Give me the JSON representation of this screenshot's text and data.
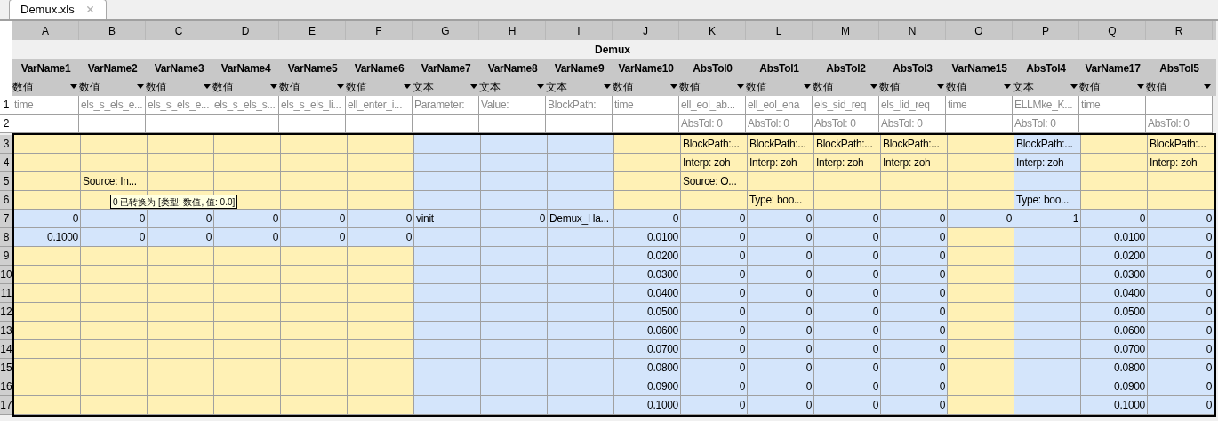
{
  "tab": {
    "title": "Demux.xls",
    "selected": true
  },
  "title": "Demux",
  "columns": [
    {
      "letter": "A",
      "name": "VarName1",
      "type": "数值"
    },
    {
      "letter": "B",
      "name": "VarName2",
      "type": "数值"
    },
    {
      "letter": "C",
      "name": "VarName3",
      "type": "数值"
    },
    {
      "letter": "D",
      "name": "VarName4",
      "type": "数值"
    },
    {
      "letter": "E",
      "name": "VarName5",
      "type": "数值"
    },
    {
      "letter": "F",
      "name": "VarName6",
      "type": "数值"
    },
    {
      "letter": "G",
      "name": "VarName7",
      "type": "文本"
    },
    {
      "letter": "H",
      "name": "VarName8",
      "type": "文本"
    },
    {
      "letter": "I",
      "name": "VarName9",
      "type": "文本"
    },
    {
      "letter": "J",
      "name": "VarName10",
      "type": "数值"
    },
    {
      "letter": "K",
      "name": "AbsTol0",
      "type": "数值"
    },
    {
      "letter": "L",
      "name": "AbsTol1",
      "type": "数值"
    },
    {
      "letter": "M",
      "name": "AbsTol2",
      "type": "数值"
    },
    {
      "letter": "N",
      "name": "AbsTol3",
      "type": "数值"
    },
    {
      "letter": "O",
      "name": "VarName15",
      "type": "数值"
    },
    {
      "letter": "P",
      "name": "AbsTol4",
      "type": "文本"
    },
    {
      "letter": "Q",
      "name": "VarName17",
      "type": "数值"
    },
    {
      "letter": "R",
      "name": "AbsTol5",
      "type": "数值"
    }
  ],
  "rows": [
    {
      "number": "1",
      "kind": "meta",
      "cells": [
        {
          "text": "time"
        },
        {
          "text": "els_s_els_e..."
        },
        {
          "text": "els_s_els_e..."
        },
        {
          "text": "els_s_els_s..."
        },
        {
          "text": "els_s_els_li..."
        },
        {
          "text": "ell_enter_i..."
        },
        {
          "text": "Parameter:"
        },
        {
          "text": "Value:"
        },
        {
          "text": "BlockPath:"
        },
        {
          "text": "time"
        },
        {
          "text": "ell_eol_ab..."
        },
        {
          "text": "ell_eol_ena"
        },
        {
          "text": "els_sid_req"
        },
        {
          "text": "els_lid_req"
        },
        {
          "text": "time"
        },
        {
          "text": "ELLMke_K..."
        },
        {
          "text": "time"
        },
        {}
      ]
    },
    {
      "number": "2",
      "kind": "meta",
      "cells": [
        {},
        {},
        {},
        {},
        {},
        {},
        {},
        {},
        {},
        {},
        {
          "text": "AbsTol: 0"
        },
        {
          "text": "AbsTol: 0"
        },
        {
          "text": "AbsTol: 0"
        },
        {
          "text": "AbsTol: 0"
        },
        {},
        {
          "text": "AbsTol: 0"
        },
        {},
        {
          "text": "AbsTol: 0"
        }
      ]
    },
    {
      "number": "3",
      "kind": "data",
      "cells": [
        {
          "color": "#fff1b5"
        },
        {
          "color": "#fff1b5"
        },
        {
          "color": "#fff1b5"
        },
        {
          "color": "#fff1b5"
        },
        {
          "color": "#fff1b5"
        },
        {
          "color": "#fff1b5"
        },
        {
          "color": "#d4e5fb"
        },
        {
          "color": "#d4e5fb"
        },
        {
          "color": "#d4e5fb"
        },
        {
          "color": "#fff1b5"
        },
        {
          "text": "BlockPath:...",
          "kind": "text",
          "color": "#fff1b5"
        },
        {
          "text": "BlockPath:...",
          "kind": "text",
          "color": "#fff1b5"
        },
        {
          "text": "BlockPath:...",
          "kind": "text",
          "color": "#fff1b5"
        },
        {
          "text": "BlockPath:...",
          "kind": "text",
          "color": "#fff1b5"
        },
        {
          "color": "#fff1b5"
        },
        {
          "text": "BlockPath:...",
          "kind": "text",
          "color": "#d4e5fb"
        },
        {
          "color": "#fff1b5"
        },
        {
          "text": "BlockPath:...",
          "kind": "text",
          "color": "#fff1b5"
        }
      ]
    },
    {
      "number": "4",
      "kind": "data",
      "cells": [
        {
          "color": "#fff1b5"
        },
        {
          "color": "#fff1b5"
        },
        {
          "color": "#fff1b5"
        },
        {
          "color": "#fff1b5"
        },
        {
          "color": "#fff1b5"
        },
        {
          "color": "#fff1b5"
        },
        {
          "color": "#d4e5fb"
        },
        {
          "color": "#d4e5fb"
        },
        {
          "color": "#d4e5fb"
        },
        {
          "color": "#fff1b5"
        },
        {
          "text": "Interp: zoh",
          "kind": "text",
          "color": "#fff1b5"
        },
        {
          "text": "Interp: zoh",
          "kind": "text",
          "color": "#fff1b5"
        },
        {
          "text": "Interp: zoh",
          "kind": "text",
          "color": "#fff1b5"
        },
        {
          "text": "Interp: zoh",
          "kind": "text",
          "color": "#fff1b5"
        },
        {
          "color": "#fff1b5"
        },
        {
          "text": "Interp: zoh",
          "kind": "text",
          "color": "#d4e5fb"
        },
        {
          "color": "#fff1b5"
        },
        {
          "text": "Interp: zoh",
          "kind": "text",
          "color": "#fff1b5"
        }
      ]
    },
    {
      "number": "5",
      "kind": "data",
      "cells": [
        {
          "color": "#fff1b5"
        },
        {
          "text": "Source: In...",
          "kind": "text",
          "color": "#fff1b5"
        },
        {
          "color": "#fff1b5"
        },
        {
          "color": "#fff1b5"
        },
        {
          "color": "#fff1b5"
        },
        {
          "color": "#fff1b5"
        },
        {
          "color": "#d4e5fb"
        },
        {
          "color": "#d4e5fb"
        },
        {
          "color": "#d4e5fb"
        },
        {
          "color": "#fff1b5"
        },
        {
          "text": "Source: O...",
          "kind": "text",
          "color": "#fff1b5"
        },
        {
          "color": "#fff1b5"
        },
        {
          "color": "#fff1b5"
        },
        {
          "color": "#fff1b5"
        },
        {
          "color": "#fff1b5"
        },
        {
          "color": "#d4e5fb"
        },
        {
          "color": "#fff1b5"
        },
        {
          "color": "#fff1b5"
        }
      ]
    },
    {
      "number": "6",
      "kind": "data",
      "cells": [
        {
          "color": "#fff1b5"
        },
        {
          "color": "#fff1b5"
        },
        {
          "color": "#fff1b5"
        },
        {
          "color": "#fff1b5"
        },
        {
          "color": "#fff1b5"
        },
        {
          "color": "#fff1b5"
        },
        {
          "color": "#d4e5fb"
        },
        {
          "color": "#d4e5fb"
        },
        {
          "color": "#d4e5fb"
        },
        {
          "color": "#fff1b5"
        },
        {
          "color": "#fff1b5"
        },
        {
          "text": "Type: boo...",
          "kind": "text",
          "color": "#fff1b5"
        },
        {
          "color": "#fff1b5"
        },
        {
          "color": "#fff1b5"
        },
        {
          "color": "#fff1b5"
        },
        {
          "text": "Type: boo...",
          "kind": "text",
          "color": "#d4e5fb"
        },
        {
          "color": "#fff1b5"
        },
        {
          "color": "#fff1b5"
        }
      ]
    },
    {
      "number": "7",
      "kind": "data",
      "cells": [
        {
          "text": "0",
          "kind": "number",
          "color": "#d4e5fb"
        },
        {
          "text": "0",
          "kind": "number",
          "color": "#d4e5fb"
        },
        {
          "text": "0",
          "kind": "number",
          "color": "#d4e5fb"
        },
        {
          "text": "0",
          "kind": "number",
          "color": "#d4e5fb"
        },
        {
          "text": "0",
          "kind": "number",
          "color": "#d4e5fb"
        },
        {
          "text": "0",
          "kind": "number",
          "color": "#d4e5fb"
        },
        {
          "text": "vinit",
          "kind": "text",
          "color": "#d4e5fb"
        },
        {
          "text": "0",
          "kind": "number",
          "color": "#d4e5fb"
        },
        {
          "text": "Demux_Ha...",
          "kind": "text",
          "color": "#d4e5fb"
        },
        {
          "text": "0",
          "kind": "number",
          "color": "#d4e5fb"
        },
        {
          "text": "0",
          "kind": "number",
          "color": "#d4e5fb"
        },
        {
          "text": "0",
          "kind": "number",
          "color": "#d4e5fb"
        },
        {
          "text": "0",
          "kind": "number",
          "color": "#d4e5fb"
        },
        {
          "text": "0",
          "kind": "number",
          "color": "#d4e5fb"
        },
        {
          "text": "0",
          "kind": "number",
          "color": "#d4e5fb"
        },
        {
          "text": "1",
          "kind": "number",
          "color": "#d4e5fb"
        },
        {
          "text": "0",
          "kind": "number",
          "color": "#d4e5fb"
        },
        {
          "text": "0",
          "kind": "number",
          "color": "#d4e5fb"
        }
      ]
    },
    {
      "number": "8",
      "kind": "data",
      "cells": [
        {
          "text": "0.1000",
          "kind": "number",
          "color": "#d4e5fb"
        },
        {
          "text": "0",
          "kind": "number",
          "color": "#d4e5fb"
        },
        {
          "text": "0",
          "kind": "number",
          "color": "#d4e5fb"
        },
        {
          "text": "0",
          "kind": "number",
          "color": "#d4e5fb"
        },
        {
          "text": "0",
          "kind": "number",
          "color": "#d4e5fb"
        },
        {
          "text": "0",
          "kind": "number",
          "color": "#d4e5fb"
        },
        {
          "color": "#d4e5fb"
        },
        {
          "color": "#d4e5fb"
        },
        {
          "color": "#d4e5fb"
        },
        {
          "text": "0.0100",
          "kind": "number",
          "color": "#d4e5fb"
        },
        {
          "text": "0",
          "kind": "number",
          "color": "#d4e5fb"
        },
        {
          "text": "0",
          "kind": "number",
          "color": "#d4e5fb"
        },
        {
          "text": "0",
          "kind": "number",
          "color": "#d4e5fb"
        },
        {
          "text": "0",
          "kind": "number",
          "color": "#d4e5fb"
        },
        {
          "color": "#fff1b5"
        },
        {
          "color": "#d4e5fb"
        },
        {
          "text": "0.0100",
          "kind": "number",
          "color": "#d4e5fb"
        },
        {
          "text": "0",
          "kind": "number",
          "color": "#d4e5fb"
        }
      ]
    },
    {
      "number": "9",
      "kind": "data",
      "cells": [
        {
          "color": "#fff1b5"
        },
        {
          "color": "#fff1b5"
        },
        {
          "color": "#fff1b5"
        },
        {
          "color": "#fff1b5"
        },
        {
          "color": "#fff1b5"
        },
        {
          "color": "#fff1b5"
        },
        {
          "color": "#d4e5fb"
        },
        {
          "color": "#d4e5fb"
        },
        {
          "color": "#d4e5fb"
        },
        {
          "text": "0.0200",
          "kind": "number",
          "color": "#d4e5fb"
        },
        {
          "text": "0",
          "kind": "number",
          "color": "#d4e5fb"
        },
        {
          "text": "0",
          "kind": "number",
          "color": "#d4e5fb"
        },
        {
          "text": "0",
          "kind": "number",
          "color": "#d4e5fb"
        },
        {
          "text": "0",
          "kind": "number",
          "color": "#d4e5fb"
        },
        {
          "color": "#fff1b5"
        },
        {
          "color": "#d4e5fb"
        },
        {
          "text": "0.0200",
          "kind": "number",
          "color": "#d4e5fb"
        },
        {
          "text": "0",
          "kind": "number",
          "color": "#d4e5fb"
        }
      ]
    },
    {
      "number": "10",
      "kind": "data",
      "cells": [
        {
          "color": "#fff1b5"
        },
        {
          "color": "#fff1b5"
        },
        {
          "color": "#fff1b5"
        },
        {
          "color": "#fff1b5"
        },
        {
          "color": "#fff1b5"
        },
        {
          "color": "#fff1b5"
        },
        {
          "color": "#d4e5fb"
        },
        {
          "color": "#d4e5fb"
        },
        {
          "color": "#d4e5fb"
        },
        {
          "text": "0.0300",
          "kind": "number",
          "color": "#d4e5fb"
        },
        {
          "text": "0",
          "kind": "number",
          "color": "#d4e5fb"
        },
        {
          "text": "0",
          "kind": "number",
          "color": "#d4e5fb"
        },
        {
          "text": "0",
          "kind": "number",
          "color": "#d4e5fb"
        },
        {
          "text": "0",
          "kind": "number",
          "color": "#d4e5fb"
        },
        {
          "color": "#fff1b5"
        },
        {
          "color": "#d4e5fb"
        },
        {
          "text": "0.0300",
          "kind": "number",
          "color": "#d4e5fb"
        },
        {
          "text": "0",
          "kind": "number",
          "color": "#d4e5fb"
        }
      ]
    },
    {
      "number": "11",
      "kind": "data",
      "cells": [
        {
          "color": "#fff1b5"
        },
        {
          "color": "#fff1b5"
        },
        {
          "color": "#fff1b5"
        },
        {
          "color": "#fff1b5"
        },
        {
          "color": "#fff1b5"
        },
        {
          "color": "#fff1b5"
        },
        {
          "color": "#d4e5fb"
        },
        {
          "color": "#d4e5fb"
        },
        {
          "color": "#d4e5fb"
        },
        {
          "text": "0.0400",
          "kind": "number",
          "color": "#d4e5fb"
        },
        {
          "text": "0",
          "kind": "number",
          "color": "#d4e5fb"
        },
        {
          "text": "0",
          "kind": "number",
          "color": "#d4e5fb"
        },
        {
          "text": "0",
          "kind": "number",
          "color": "#d4e5fb"
        },
        {
          "text": "0",
          "kind": "number",
          "color": "#d4e5fb"
        },
        {
          "color": "#fff1b5"
        },
        {
          "color": "#d4e5fb"
        },
        {
          "text": "0.0400",
          "kind": "number",
          "color": "#d4e5fb"
        },
        {
          "text": "0",
          "kind": "number",
          "color": "#d4e5fb"
        }
      ]
    },
    {
      "number": "12",
      "kind": "data",
      "cells": [
        {
          "color": "#fff1b5"
        },
        {
          "color": "#fff1b5"
        },
        {
          "color": "#fff1b5"
        },
        {
          "color": "#fff1b5"
        },
        {
          "color": "#fff1b5"
        },
        {
          "color": "#fff1b5"
        },
        {
          "color": "#d4e5fb"
        },
        {
          "color": "#d4e5fb"
        },
        {
          "color": "#d4e5fb"
        },
        {
          "text": "0.0500",
          "kind": "number",
          "color": "#d4e5fb"
        },
        {
          "text": "0",
          "kind": "number",
          "color": "#d4e5fb"
        },
        {
          "text": "0",
          "kind": "number",
          "color": "#d4e5fb"
        },
        {
          "text": "0",
          "kind": "number",
          "color": "#d4e5fb"
        },
        {
          "text": "0",
          "kind": "number",
          "color": "#d4e5fb"
        },
        {
          "color": "#fff1b5"
        },
        {
          "color": "#d4e5fb"
        },
        {
          "text": "0.0500",
          "kind": "number",
          "color": "#d4e5fb"
        },
        {
          "text": "0",
          "kind": "number",
          "color": "#d4e5fb"
        }
      ]
    },
    {
      "number": "13",
      "kind": "data",
      "cells": [
        {
          "color": "#fff1b5"
        },
        {
          "color": "#fff1b5"
        },
        {
          "color": "#fff1b5"
        },
        {
          "color": "#fff1b5"
        },
        {
          "color": "#fff1b5"
        },
        {
          "color": "#fff1b5"
        },
        {
          "color": "#d4e5fb"
        },
        {
          "color": "#d4e5fb"
        },
        {
          "color": "#d4e5fb"
        },
        {
          "text": "0.0600",
          "kind": "number",
          "color": "#d4e5fb"
        },
        {
          "text": "0",
          "kind": "number",
          "color": "#d4e5fb"
        },
        {
          "text": "0",
          "kind": "number",
          "color": "#d4e5fb"
        },
        {
          "text": "0",
          "kind": "number",
          "color": "#d4e5fb"
        },
        {
          "text": "0",
          "kind": "number",
          "color": "#d4e5fb"
        },
        {
          "color": "#fff1b5"
        },
        {
          "color": "#d4e5fb"
        },
        {
          "text": "0.0600",
          "kind": "number",
          "color": "#d4e5fb"
        },
        {
          "text": "0",
          "kind": "number",
          "color": "#d4e5fb"
        }
      ]
    },
    {
      "number": "14",
      "kind": "data",
      "cells": [
        {
          "color": "#fff1b5"
        },
        {
          "color": "#fff1b5"
        },
        {
          "color": "#fff1b5"
        },
        {
          "color": "#fff1b5"
        },
        {
          "color": "#fff1b5"
        },
        {
          "color": "#fff1b5"
        },
        {
          "color": "#d4e5fb"
        },
        {
          "color": "#d4e5fb"
        },
        {
          "color": "#d4e5fb"
        },
        {
          "text": "0.0700",
          "kind": "number",
          "color": "#d4e5fb"
        },
        {
          "text": "0",
          "kind": "number",
          "color": "#d4e5fb"
        },
        {
          "text": "0",
          "kind": "number",
          "color": "#d4e5fb"
        },
        {
          "text": "0",
          "kind": "number",
          "color": "#d4e5fb"
        },
        {
          "text": "0",
          "kind": "number",
          "color": "#d4e5fb"
        },
        {
          "color": "#fff1b5"
        },
        {
          "color": "#d4e5fb"
        },
        {
          "text": "0.0700",
          "kind": "number",
          "color": "#d4e5fb"
        },
        {
          "text": "0",
          "kind": "number",
          "color": "#d4e5fb"
        }
      ]
    },
    {
      "number": "15",
      "kind": "data",
      "cells": [
        {
          "color": "#fff1b5"
        },
        {
          "color": "#fff1b5"
        },
        {
          "color": "#fff1b5"
        },
        {
          "color": "#fff1b5"
        },
        {
          "color": "#fff1b5"
        },
        {
          "color": "#fff1b5"
        },
        {
          "color": "#d4e5fb"
        },
        {
          "color": "#d4e5fb"
        },
        {
          "color": "#d4e5fb"
        },
        {
          "text": "0.0800",
          "kind": "number",
          "color": "#d4e5fb"
        },
        {
          "text": "0",
          "kind": "number",
          "color": "#d4e5fb"
        },
        {
          "text": "0",
          "kind": "number",
          "color": "#d4e5fb"
        },
        {
          "text": "0",
          "kind": "number",
          "color": "#d4e5fb"
        },
        {
          "text": "0",
          "kind": "number",
          "color": "#d4e5fb"
        },
        {
          "color": "#fff1b5"
        },
        {
          "color": "#d4e5fb"
        },
        {
          "text": "0.0800",
          "kind": "number",
          "color": "#d4e5fb"
        },
        {
          "text": "0",
          "kind": "number",
          "color": "#d4e5fb"
        }
      ]
    },
    {
      "number": "16",
      "kind": "data",
      "cells": [
        {
          "color": "#fff1b5"
        },
        {
          "color": "#fff1b5"
        },
        {
          "color": "#fff1b5"
        },
        {
          "color": "#fff1b5"
        },
        {
          "color": "#fff1b5"
        },
        {
          "color": "#fff1b5"
        },
        {
          "color": "#d4e5fb"
        },
        {
          "color": "#d4e5fb"
        },
        {
          "color": "#d4e5fb"
        },
        {
          "text": "0.0900",
          "kind": "number",
          "color": "#d4e5fb"
        },
        {
          "text": "0",
          "kind": "number",
          "color": "#d4e5fb"
        },
        {
          "text": "0",
          "kind": "number",
          "color": "#d4e5fb"
        },
        {
          "text": "0",
          "kind": "number",
          "color": "#d4e5fb"
        },
        {
          "text": "0",
          "kind": "number",
          "color": "#d4e5fb"
        },
        {
          "color": "#fff1b5"
        },
        {
          "color": "#d4e5fb"
        },
        {
          "text": "0.0900",
          "kind": "number",
          "color": "#d4e5fb"
        },
        {
          "text": "0",
          "kind": "number",
          "color": "#d4e5fb"
        }
      ]
    },
    {
      "number": "17",
      "kind": "data",
      "cells": [
        {
          "color": "#fff1b5"
        },
        {
          "color": "#fff1b5"
        },
        {
          "color": "#fff1b5"
        },
        {
          "color": "#fff1b5"
        },
        {
          "color": "#fff1b5"
        },
        {
          "color": "#fff1b5"
        },
        {
          "color": "#d4e5fb"
        },
        {
          "color": "#d4e5fb"
        },
        {
          "color": "#d4e5fb"
        },
        {
          "text": "0.1000",
          "kind": "number",
          "color": "#d4e5fb"
        },
        {
          "text": "0",
          "kind": "number",
          "color": "#d4e5fb"
        },
        {
          "text": "0",
          "kind": "number",
          "color": "#d4e5fb"
        },
        {
          "text": "0",
          "kind": "number",
          "color": "#d4e5fb"
        },
        {
          "text": "0",
          "kind": "number",
          "color": "#d4e5fb"
        },
        {
          "color": "#fff1b5"
        },
        {
          "color": "#d4e5fb"
        },
        {
          "text": "0.1000",
          "kind": "number",
          "color": "#d4e5fb"
        },
        {
          "text": "0",
          "kind": "number",
          "color": "#d4e5fb"
        }
      ]
    }
  ],
  "tooltip": {
    "text": "0 已转换为 [类型: 数值, 值: 0.0]"
  }
}
